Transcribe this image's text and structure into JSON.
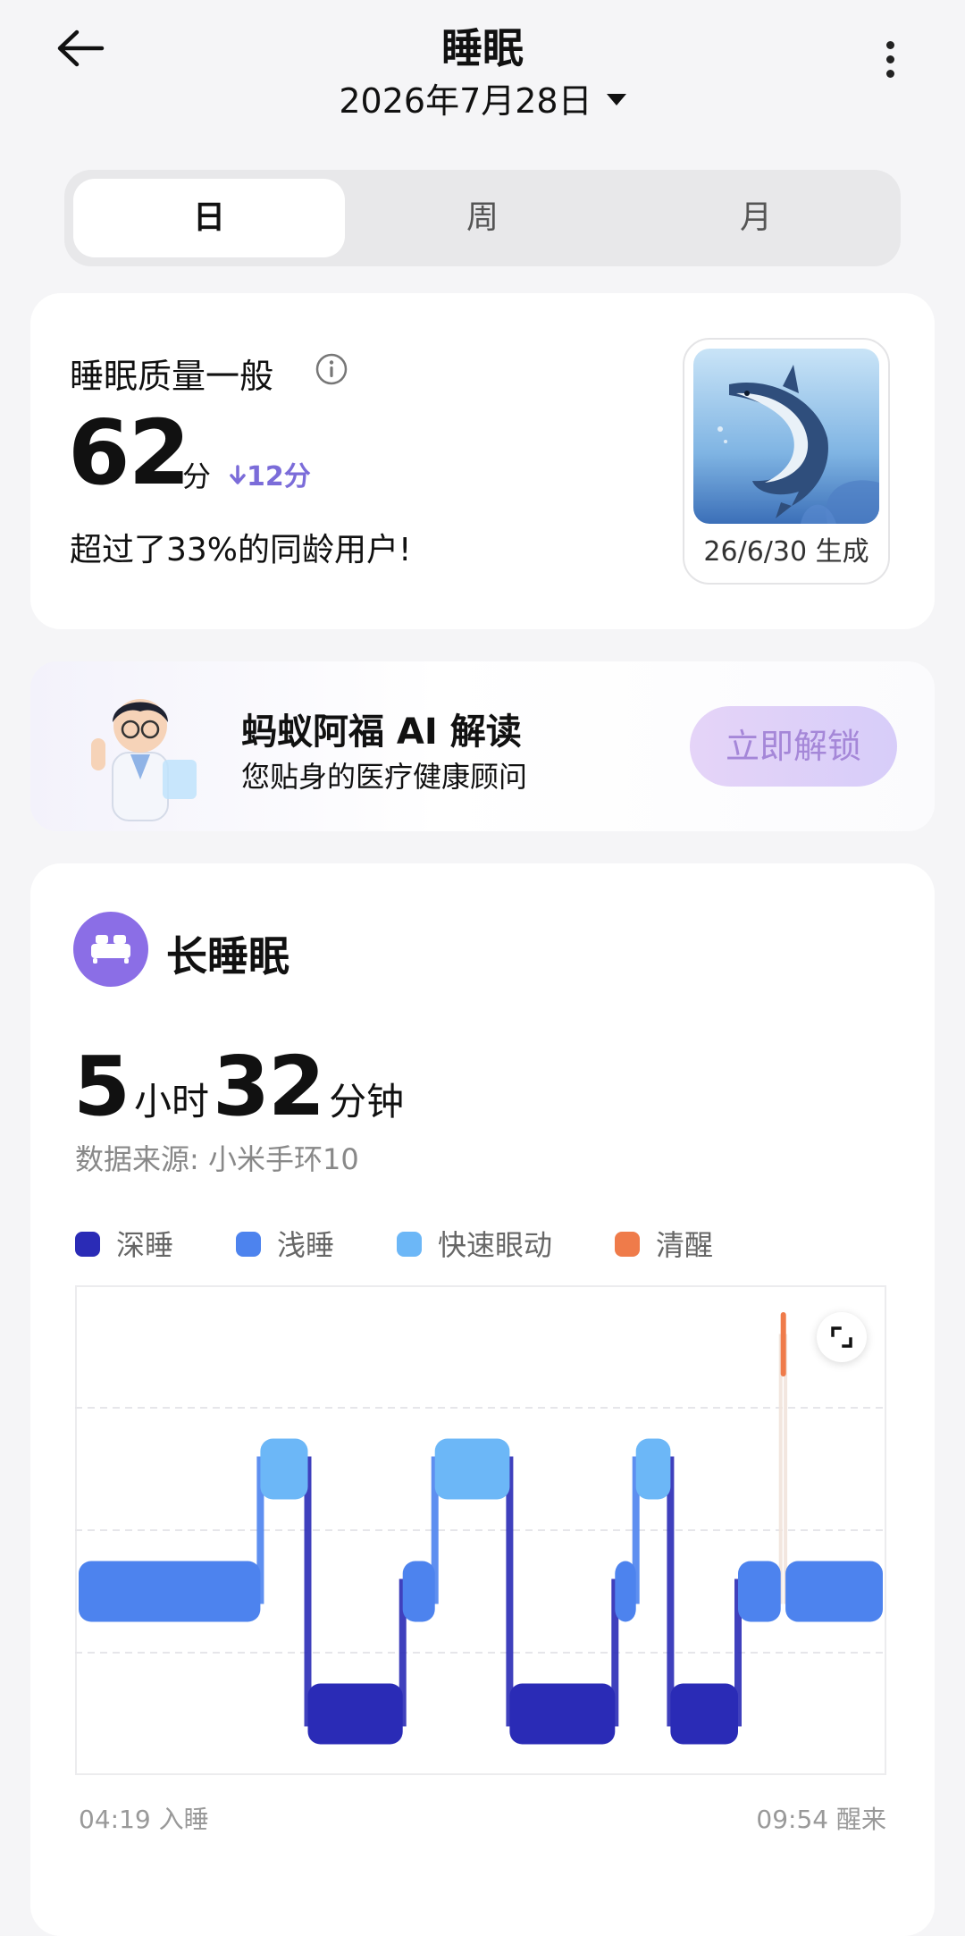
{
  "header": {
    "title": "睡眠",
    "date": "2026年7月28日"
  },
  "tabs": [
    {
      "label": "日",
      "active": true
    },
    {
      "label": "周",
      "active": false
    },
    {
      "label": "月",
      "active": false
    }
  ],
  "score_card": {
    "quality_label": "睡眠质量一般",
    "score": "62",
    "score_unit": "分",
    "delta": "12分",
    "rank_text": "超过了33%的同龄用户!",
    "thumb_caption": "26/6/30 生成"
  },
  "ai_card": {
    "title": "蚂蚁阿福 AI 解读",
    "subtitle": "您贴身的医疗健康顾问",
    "button": "立即解锁"
  },
  "sleep_card": {
    "type_label": "长睡眠",
    "hours": "5",
    "hours_unit": "小时",
    "minutes": "32",
    "minutes_unit": "分钟",
    "source": "数据来源: 小米手环10",
    "start_label": "04:19 入睡",
    "end_label": "09:54 醒来"
  },
  "colors": {
    "deep": "#2a2bb6",
    "light": "#4d83ee",
    "rem": "#6cb7f7",
    "awake": "#ef7b4a",
    "accent": "#8b6ee6"
  },
  "chart_data": {
    "type": "bar",
    "legend": [
      "深睡",
      "浅睡",
      "快速眼动",
      "清醒"
    ],
    "x_start": "04:19",
    "x_end": "09:54",
    "stages": [
      "清醒",
      "快速眼动",
      "浅睡",
      "深睡"
    ],
    "segments": [
      {
        "stage": "浅睡",
        "start": 0.0,
        "end": 0.226
      },
      {
        "stage": "快速眼动",
        "start": 0.226,
        "end": 0.285
      },
      {
        "stage": "深睡",
        "start": 0.285,
        "end": 0.403
      },
      {
        "stage": "浅睡",
        "start": 0.403,
        "end": 0.443
      },
      {
        "stage": "快速眼动",
        "start": 0.443,
        "end": 0.536
      },
      {
        "stage": "深睡",
        "start": 0.536,
        "end": 0.667
      },
      {
        "stage": "浅睡",
        "start": 0.667,
        "end": 0.693
      },
      {
        "stage": "快速眼动",
        "start": 0.693,
        "end": 0.736
      },
      {
        "stage": "深睡",
        "start": 0.736,
        "end": 0.82
      },
      {
        "stage": "浅睡",
        "start": 0.82,
        "end": 0.873
      },
      {
        "stage": "清醒",
        "start": 0.873,
        "end": 0.879
      },
      {
        "stage": "浅睡",
        "start": 0.879,
        "end": 1.0
      }
    ]
  }
}
